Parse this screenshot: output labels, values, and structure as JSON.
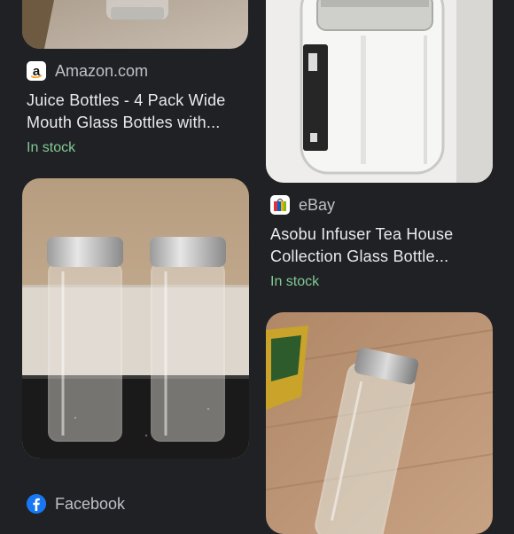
{
  "results": [
    {
      "source_name": "Amazon.com",
      "source_icon": "amazon-logo-icon",
      "title_line1": "Juice Bottles - 4 Pack Wide",
      "title_line2": "Mouth Glass Bottles with...",
      "availability": "In stock"
    },
    {
      "source_name": "eBay",
      "source_icon": "ebay-bag-icon",
      "title_line1": "Asobu Infuser Tea House",
      "title_line2": "Collection Glass Bottle...",
      "availability": "In stock"
    },
    {
      "source_name": "Facebook",
      "source_icon": "facebook-logo-icon"
    }
  ],
  "colors": {
    "background": "#202124",
    "text": "#e8eaed",
    "source_text": "#bdc1c6",
    "in_stock": "#81c995",
    "facebook_blue": "#1877f2"
  }
}
